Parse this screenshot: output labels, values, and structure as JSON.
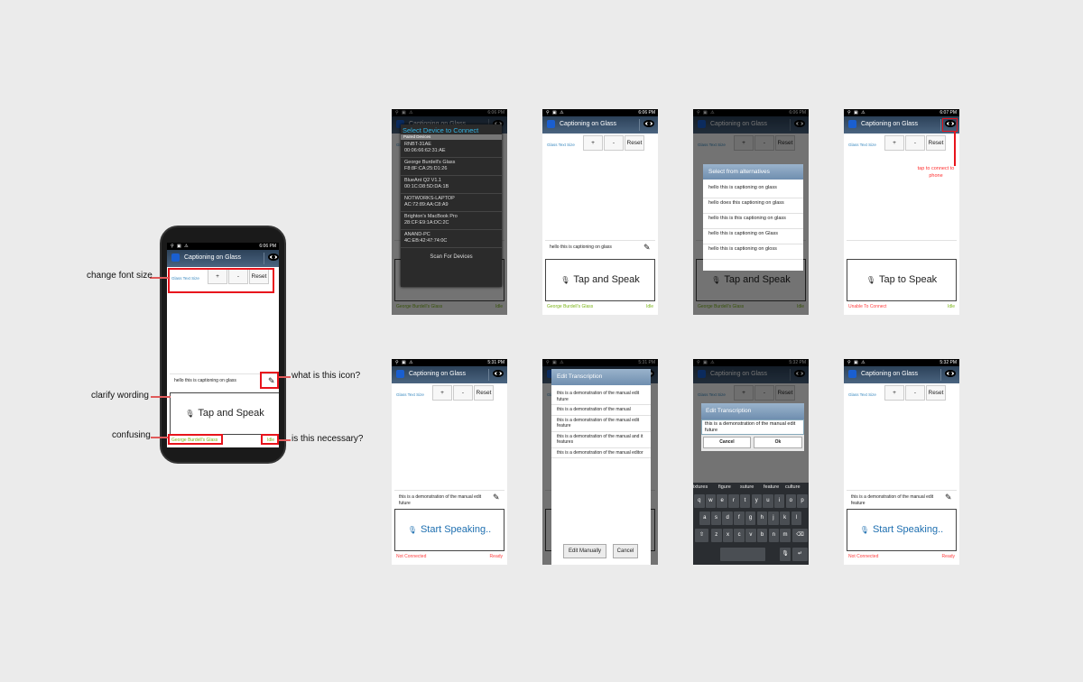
{
  "app_title": "Captioning on Glass",
  "text_size_label": "Glass Text Size",
  "plus": "+",
  "minus": "-",
  "reset": "Reset",
  "colors": {
    "status_green": "#7cb518",
    "status_red": "#ff4040",
    "accent_blue": "#3a8ac0",
    "speak_blue": "#1e6fb0",
    "annotation_red": "#e8141c"
  },
  "annotated": {
    "time": "6:06 PM",
    "caption": "hello this is captioning on glass",
    "button": "Tap and Speak",
    "footer_left": "George Burdell's Glass",
    "footer_right": "Idle",
    "annotations": {
      "font_size": "change font size",
      "icon": "what is this icon?",
      "wording": "clarify wording",
      "confusing": "confusing",
      "necessary": "is this necessary?"
    }
  },
  "screens": [
    {
      "time": "6:06 PM",
      "caption": "",
      "button": "Tap and Speak",
      "button_color": "#222",
      "footer_left": "George Burdell's Glass",
      "footer_left_color": "#7cb518",
      "footer_right": "Idle",
      "footer_right_color": "#7cb518",
      "dimmed": true,
      "dialog": {
        "type": "devices",
        "title": "Select Device to Connect",
        "subheader": "Paired Devices",
        "devices": [
          {
            "name": "RNBT-31AE",
            "mac": "00:06:66:62:31:AE"
          },
          {
            "name": "George Burdell's Glass",
            "mac": "F8:8F:CA:25:D1:26"
          },
          {
            "name": "BlueAnt Q2 V1.1",
            "mac": "00:1C:D8:5D:DA:1B"
          },
          {
            "name": "NOTWORKS-LAPTOP",
            "mac": "AC:72:89:AA:C8:A9"
          },
          {
            "name": "Brighton's MacBook Pro",
            "mac": "28:CF:E9:1A:DC:2C"
          },
          {
            "name": "ANAND-PC",
            "mac": "4C:EB:42:47:74:0C"
          }
        ],
        "scan": "Scan For Devices"
      }
    },
    {
      "time": "6:06 PM",
      "caption": "hello this is captioning on glass",
      "button": "Tap and Speak",
      "button_color": "#222",
      "footer_left": "George Burdell's Glass",
      "footer_left_color": "#7cb518",
      "footer_right": "Idle",
      "footer_right_color": "#7cb518",
      "dimmed": false
    },
    {
      "time": "6:06 PM",
      "caption": "",
      "button": "Tap and Speak",
      "button_color": "#222",
      "footer_left": "George Burdell's Glass",
      "footer_left_color": "#7cb518",
      "footer_right": "Idle",
      "footer_right_color": "#7cb518",
      "dimmed": true,
      "dialog": {
        "type": "alternatives",
        "title": "Select from alternatives",
        "items": [
          "hello this is captioning on glass",
          "hello does this captioning on glass",
          "hello this is this captioning on glass",
          "hello this is captioning on Glass",
          "hello this is captioning on gloss"
        ]
      }
    },
    {
      "time": "6:07 PM",
      "caption": "",
      "button": "Tap to Speak",
      "button_color": "#222",
      "footer_left": "Unable To Connect",
      "footer_left_color": "#ff4040",
      "footer_right": "Idle",
      "footer_right_color": "#7cb518",
      "dimmed": false,
      "annotation": "tap to connect to phone"
    },
    {
      "time": "5:31 PM",
      "caption": "this is a demonstration of the manual edit future",
      "button": "Start Speaking..",
      "button_color": "#1e6fb0",
      "footer_left": "Not Connected",
      "footer_left_color": "#ff4040",
      "footer_right": "Ready",
      "footer_right_color": "#ff4040",
      "dimmed": false
    },
    {
      "time": "5:31 PM",
      "caption": "",
      "button": "",
      "button_color": "#1e6fb0",
      "footer_left": "",
      "footer_left_color": "#ff4040",
      "footer_right": "",
      "footer_right_color": "#ff4040",
      "dimmed": true,
      "dialog": {
        "type": "edit_list",
        "title": "Edit Transcription",
        "items": [
          "this is a demonstration of the manual edit future",
          "this is a demonstration of the manual",
          "this is a demonstration of the manual edit feature",
          "this is a demonstration of the manual and it features",
          "this is a demonstration of the manual editor"
        ],
        "edit_manually": "Edit Manually",
        "cancel": "Cancel"
      }
    },
    {
      "time": "5:32 PM",
      "caption": "",
      "button": "Start Speaking..",
      "button_color": "#1e6fb0",
      "footer_left": "Not Connected",
      "footer_left_color": "#ff4040",
      "footer_right": "Ready",
      "footer_right_color": "#ff4040",
      "dimmed": true,
      "dialog": {
        "type": "edit_text",
        "title": "Edit Transcription",
        "value": "this is a demonstration of the manual edit future",
        "cancel": "Cancel",
        "ok": "Ok"
      },
      "keyboard": {
        "suggestions": [
          "ixtures",
          "figure",
          "suture",
          "feature",
          "culture"
        ],
        "rows": [
          [
            "q",
            "w",
            "e",
            "r",
            "t",
            "y",
            "u",
            "i",
            "o",
            "p"
          ],
          [
            "a",
            "s",
            "d",
            "f",
            "g",
            "h",
            "j",
            "k",
            "l"
          ],
          [
            "z",
            "x",
            "c",
            "v",
            "b",
            "n",
            "m"
          ]
        ]
      }
    },
    {
      "time": "5:32 PM",
      "caption": "this is a demonstration of the manual edit feature",
      "button": "Start Speaking..",
      "button_color": "#1e6fb0",
      "footer_left": "Not Connected",
      "footer_left_color": "#ff4040",
      "footer_right": "Ready",
      "footer_right_color": "#ff4040",
      "dimmed": false
    }
  ]
}
